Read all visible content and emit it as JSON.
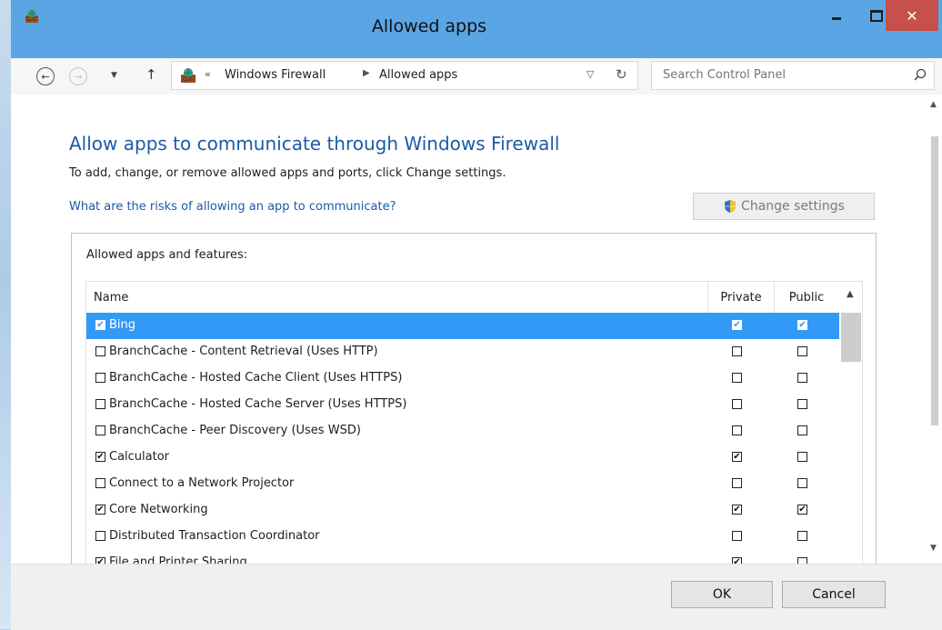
{
  "window": {
    "title": "Allowed apps"
  },
  "nav": {
    "breadcrumb": [
      "Windows Firewall",
      "Allowed apps"
    ],
    "separator": "«",
    "search_placeholder": "Search Control Panel"
  },
  "main": {
    "heading": "Allow apps to communicate through Windows Firewall",
    "subtext": "To add, change, or remove allowed apps and ports, click Change settings.",
    "risk_link": "What are the risks of allowing an app to communicate?",
    "change_settings_label": "Change settings",
    "group_label": "Allowed apps and features:",
    "columns": {
      "name": "Name",
      "private": "Private",
      "public": "Public"
    },
    "apps": [
      {
        "name": "Bing",
        "enabled": true,
        "private": true,
        "public": true,
        "selected": true
      },
      {
        "name": "BranchCache - Content Retrieval (Uses HTTP)",
        "enabled": false,
        "private": false,
        "public": false
      },
      {
        "name": "BranchCache - Hosted Cache Client (Uses HTTPS)",
        "enabled": false,
        "private": false,
        "public": false
      },
      {
        "name": "BranchCache - Hosted Cache Server (Uses HTTPS)",
        "enabled": false,
        "private": false,
        "public": false
      },
      {
        "name": "BranchCache - Peer Discovery (Uses WSD)",
        "enabled": false,
        "private": false,
        "public": false
      },
      {
        "name": "Calculator",
        "enabled": true,
        "private": true,
        "public": false
      },
      {
        "name": "Connect to a Network Projector",
        "enabled": false,
        "private": false,
        "public": false
      },
      {
        "name": "Core Networking",
        "enabled": true,
        "private": true,
        "public": true
      },
      {
        "name": "Distributed Transaction Coordinator",
        "enabled": false,
        "private": false,
        "public": false
      },
      {
        "name": "File and Printer Sharing",
        "enabled": true,
        "private": true,
        "public": false
      }
    ]
  },
  "footer": {
    "ok_label": "OK",
    "cancel_label": "Cancel"
  },
  "colors": {
    "title_bar": "#5aa6e4",
    "close": "#c7504a",
    "selection": "#3399f7",
    "link": "#1c5aa8"
  }
}
